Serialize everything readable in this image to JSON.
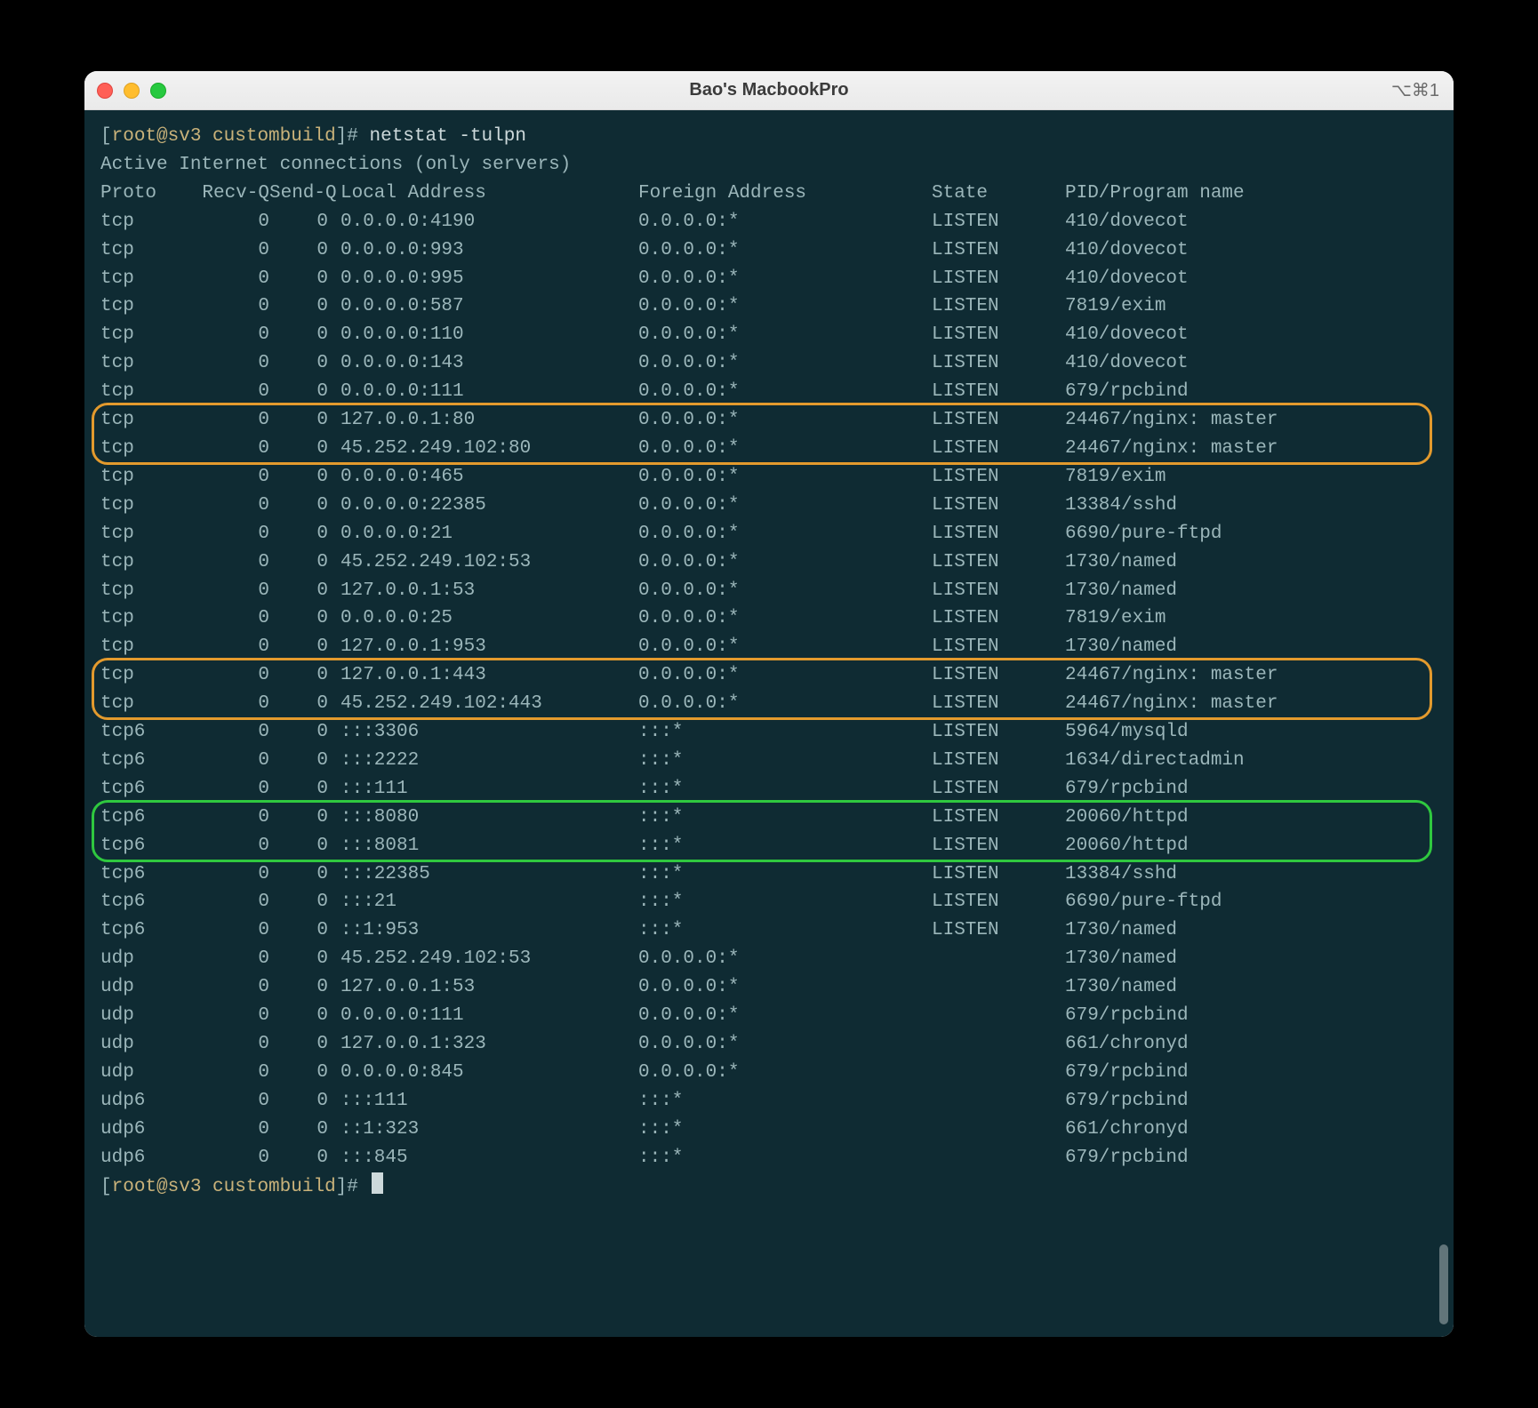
{
  "window": {
    "title": "Bao's MacbookPro",
    "shortcut": "⌥⌘1"
  },
  "prompt": {
    "user_host": "root@sv3",
    "dir": "custombuild",
    "command": "netstat -tulpn",
    "full_prefix": "[root@sv3 custombuild]#"
  },
  "header_line": "Active Internet connections (only servers)",
  "columns": {
    "proto": "Proto",
    "recvq": "Recv-Q",
    "sendq": "Send-Q",
    "local": "Local Address",
    "foreign": "Foreign Address",
    "state": "State",
    "prog": "PID/Program name"
  },
  "rows": [
    {
      "proto": "tcp",
      "recvq": "0",
      "sendq": "0",
      "local": "0.0.0.0:4190",
      "foreign": "0.0.0.0:*",
      "state": "LISTEN",
      "prog": "410/dovecot"
    },
    {
      "proto": "tcp",
      "recvq": "0",
      "sendq": "0",
      "local": "0.0.0.0:993",
      "foreign": "0.0.0.0:*",
      "state": "LISTEN",
      "prog": "410/dovecot"
    },
    {
      "proto": "tcp",
      "recvq": "0",
      "sendq": "0",
      "local": "0.0.0.0:995",
      "foreign": "0.0.0.0:*",
      "state": "LISTEN",
      "prog": "410/dovecot"
    },
    {
      "proto": "tcp",
      "recvq": "0",
      "sendq": "0",
      "local": "0.0.0.0:587",
      "foreign": "0.0.0.0:*",
      "state": "LISTEN",
      "prog": "7819/exim"
    },
    {
      "proto": "tcp",
      "recvq": "0",
      "sendq": "0",
      "local": "0.0.0.0:110",
      "foreign": "0.0.0.0:*",
      "state": "LISTEN",
      "prog": "410/dovecot"
    },
    {
      "proto": "tcp",
      "recvq": "0",
      "sendq": "0",
      "local": "0.0.0.0:143",
      "foreign": "0.0.0.0:*",
      "state": "LISTEN",
      "prog": "410/dovecot"
    },
    {
      "proto": "tcp",
      "recvq": "0",
      "sendq": "0",
      "local": "0.0.0.0:111",
      "foreign": "0.0.0.0:*",
      "state": "LISTEN",
      "prog": "679/rpcbind"
    },
    {
      "proto": "tcp",
      "recvq": "0",
      "sendq": "0",
      "local": "127.0.0.1:80",
      "foreign": "0.0.0.0:*",
      "state": "LISTEN",
      "prog": "24467/nginx: master"
    },
    {
      "proto": "tcp",
      "recvq": "0",
      "sendq": "0",
      "local": "45.252.249.102:80",
      "foreign": "0.0.0.0:*",
      "state": "LISTEN",
      "prog": "24467/nginx: master"
    },
    {
      "proto": "tcp",
      "recvq": "0",
      "sendq": "0",
      "local": "0.0.0.0:465",
      "foreign": "0.0.0.0:*",
      "state": "LISTEN",
      "prog": "7819/exim"
    },
    {
      "proto": "tcp",
      "recvq": "0",
      "sendq": "0",
      "local": "0.0.0.0:22385",
      "foreign": "0.0.0.0:*",
      "state": "LISTEN",
      "prog": "13384/sshd"
    },
    {
      "proto": "tcp",
      "recvq": "0",
      "sendq": "0",
      "local": "0.0.0.0:21",
      "foreign": "0.0.0.0:*",
      "state": "LISTEN",
      "prog": "6690/pure-ftpd"
    },
    {
      "proto": "tcp",
      "recvq": "0",
      "sendq": "0",
      "local": "45.252.249.102:53",
      "foreign": "0.0.0.0:*",
      "state": "LISTEN",
      "prog": "1730/named"
    },
    {
      "proto": "tcp",
      "recvq": "0",
      "sendq": "0",
      "local": "127.0.0.1:53",
      "foreign": "0.0.0.0:*",
      "state": "LISTEN",
      "prog": "1730/named"
    },
    {
      "proto": "tcp",
      "recvq": "0",
      "sendq": "0",
      "local": "0.0.0.0:25",
      "foreign": "0.0.0.0:*",
      "state": "LISTEN",
      "prog": "7819/exim"
    },
    {
      "proto": "tcp",
      "recvq": "0",
      "sendq": "0",
      "local": "127.0.0.1:953",
      "foreign": "0.0.0.0:*",
      "state": "LISTEN",
      "prog": "1730/named"
    },
    {
      "proto": "tcp",
      "recvq": "0",
      "sendq": "0",
      "local": "127.0.0.1:443",
      "foreign": "0.0.0.0:*",
      "state": "LISTEN",
      "prog": "24467/nginx: master"
    },
    {
      "proto": "tcp",
      "recvq": "0",
      "sendq": "0",
      "local": "45.252.249.102:443",
      "foreign": "0.0.0.0:*",
      "state": "LISTEN",
      "prog": "24467/nginx: master"
    },
    {
      "proto": "tcp6",
      "recvq": "0",
      "sendq": "0",
      "local": ":::3306",
      "foreign": ":::*",
      "state": "LISTEN",
      "prog": "5964/mysqld"
    },
    {
      "proto": "tcp6",
      "recvq": "0",
      "sendq": "0",
      "local": ":::2222",
      "foreign": ":::*",
      "state": "LISTEN",
      "prog": "1634/directadmin"
    },
    {
      "proto": "tcp6",
      "recvq": "0",
      "sendq": "0",
      "local": ":::111",
      "foreign": ":::*",
      "state": "LISTEN",
      "prog": "679/rpcbind"
    },
    {
      "proto": "tcp6",
      "recvq": "0",
      "sendq": "0",
      "local": ":::8080",
      "foreign": ":::*",
      "state": "LISTEN",
      "prog": "20060/httpd"
    },
    {
      "proto": "tcp6",
      "recvq": "0",
      "sendq": "0",
      "local": ":::8081",
      "foreign": ":::*",
      "state": "LISTEN",
      "prog": "20060/httpd"
    },
    {
      "proto": "tcp6",
      "recvq": "0",
      "sendq": "0",
      "local": ":::22385",
      "foreign": ":::*",
      "state": "LISTEN",
      "prog": "13384/sshd"
    },
    {
      "proto": "tcp6",
      "recvq": "0",
      "sendq": "0",
      "local": ":::21",
      "foreign": ":::*",
      "state": "LISTEN",
      "prog": "6690/pure-ftpd"
    },
    {
      "proto": "tcp6",
      "recvq": "0",
      "sendq": "0",
      "local": "::1:953",
      "foreign": ":::*",
      "state": "LISTEN",
      "prog": "1730/named"
    },
    {
      "proto": "udp",
      "recvq": "0",
      "sendq": "0",
      "local": "45.252.249.102:53",
      "foreign": "0.0.0.0:*",
      "state": "",
      "prog": "1730/named"
    },
    {
      "proto": "udp",
      "recvq": "0",
      "sendq": "0",
      "local": "127.0.0.1:53",
      "foreign": "0.0.0.0:*",
      "state": "",
      "prog": "1730/named"
    },
    {
      "proto": "udp",
      "recvq": "0",
      "sendq": "0",
      "local": "0.0.0.0:111",
      "foreign": "0.0.0.0:*",
      "state": "",
      "prog": "679/rpcbind"
    },
    {
      "proto": "udp",
      "recvq": "0",
      "sendq": "0",
      "local": "127.0.0.1:323",
      "foreign": "0.0.0.0:*",
      "state": "",
      "prog": "661/chronyd"
    },
    {
      "proto": "udp",
      "recvq": "0",
      "sendq": "0",
      "local": "0.0.0.0:845",
      "foreign": "0.0.0.0:*",
      "state": "",
      "prog": "679/rpcbind"
    },
    {
      "proto": "udp6",
      "recvq": "0",
      "sendq": "0",
      "local": ":::111",
      "foreign": ":::*",
      "state": "",
      "prog": "679/rpcbind"
    },
    {
      "proto": "udp6",
      "recvq": "0",
      "sendq": "0",
      "local": "::1:323",
      "foreign": ":::*",
      "state": "",
      "prog": "661/chronyd"
    },
    {
      "proto": "udp6",
      "recvq": "0",
      "sendq": "0",
      "local": ":::845",
      "foreign": ":::*",
      "state": "",
      "prog": "679/rpcbind"
    }
  ],
  "highlights": [
    {
      "color": "orange",
      "start": 7,
      "end": 8
    },
    {
      "color": "orange",
      "start": 16,
      "end": 17
    },
    {
      "color": "green",
      "start": 21,
      "end": 22
    }
  ]
}
